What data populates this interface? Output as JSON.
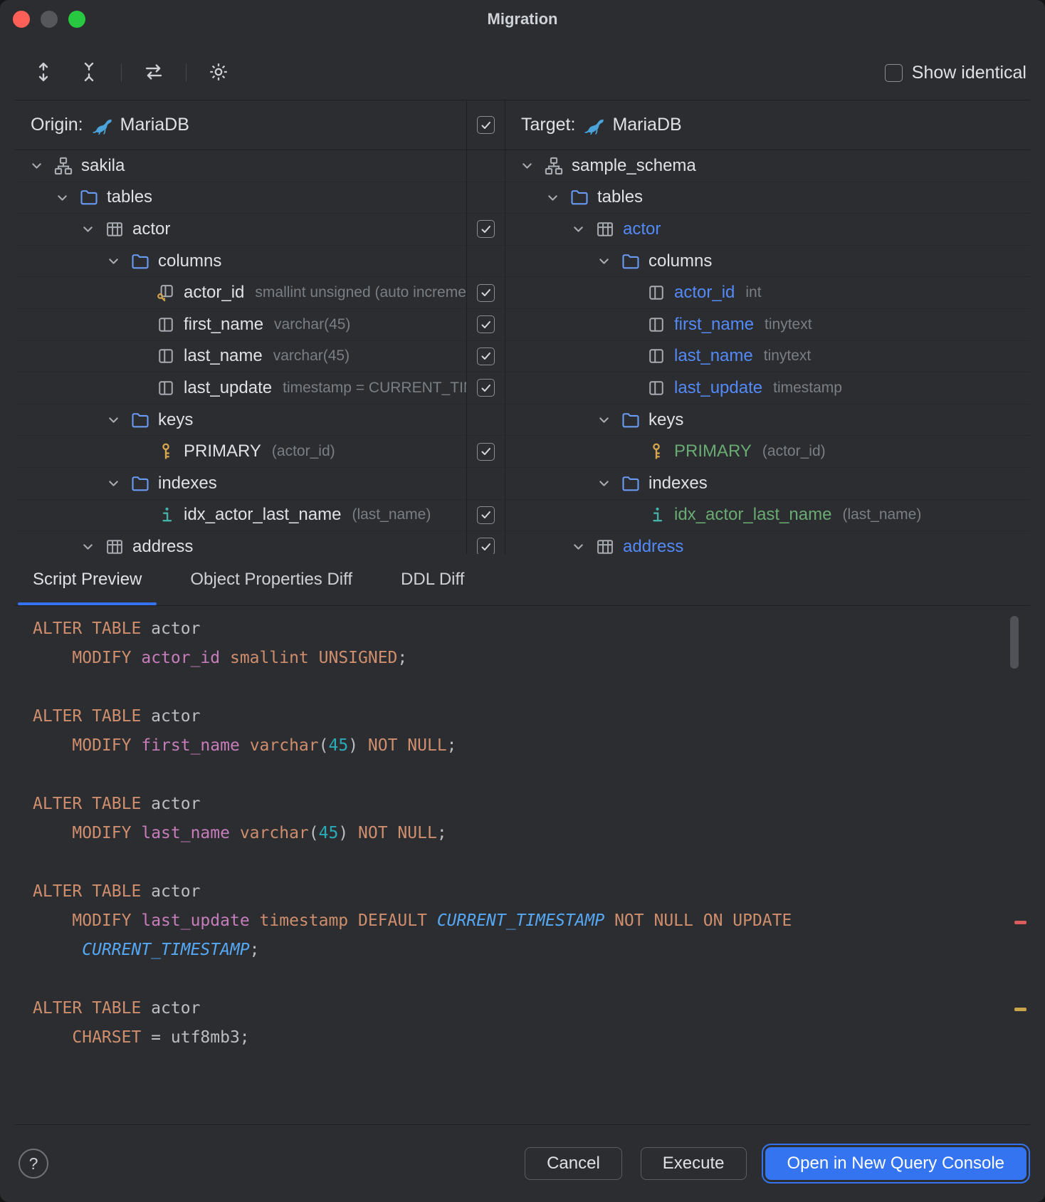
{
  "window": {
    "title": "Migration"
  },
  "colors": {
    "accent": "#3574F0",
    "modified_text": "#548AF7",
    "new_text": "#6AAB73",
    "keyword": "#CF8E6D",
    "column_name": "#C77DBB",
    "number": "#2AACB8",
    "function": "#56A8F5",
    "error_stripe_red": "#DB5C5C",
    "error_stripe_yellow": "#C8A549"
  },
  "toolbar": {
    "icons": [
      "expand-all",
      "collapse-all",
      "sync",
      "settings"
    ],
    "show_identical_label": "Show identical",
    "show_identical_checked": false
  },
  "headers": {
    "origin_label": "Origin:",
    "origin_db": "MariaDB",
    "target_label": "Target:",
    "target_db": "MariaDB",
    "select_all_checked": true
  },
  "tree": {
    "rows": [
      {
        "depth": 0,
        "left": {
          "icon": "schema",
          "label": "sakila",
          "expanded": true
        },
        "check": null,
        "right": {
          "icon": "schema",
          "label": "sample_schema",
          "expanded": true
        }
      },
      {
        "depth": 1,
        "left": {
          "icon": "folder",
          "label": "tables",
          "expanded": true
        },
        "check": null,
        "right": {
          "icon": "folder",
          "label": "tables",
          "expanded": true
        }
      },
      {
        "depth": 2,
        "left": {
          "icon": "table",
          "label": "actor",
          "expanded": true
        },
        "check": true,
        "right": {
          "icon": "table",
          "label": "actor",
          "expanded": true,
          "state": "modified"
        }
      },
      {
        "depth": 3,
        "left": {
          "icon": "folder",
          "label": "columns",
          "expanded": true
        },
        "check": null,
        "right": {
          "icon": "folder",
          "label": "columns",
          "expanded": true
        }
      },
      {
        "depth": 4,
        "left": {
          "icon": "column-key",
          "label": "actor_id",
          "hint": "smallint unsigned (auto increme"
        },
        "check": true,
        "right": {
          "icon": "column",
          "label": "actor_id",
          "hint": "int",
          "state": "modified"
        }
      },
      {
        "depth": 4,
        "left": {
          "icon": "column",
          "label": "first_name",
          "hint": "varchar(45)"
        },
        "check": true,
        "right": {
          "icon": "column",
          "label": "first_name",
          "hint": "tinytext",
          "state": "modified"
        }
      },
      {
        "depth": 4,
        "left": {
          "icon": "column",
          "label": "last_name",
          "hint": "varchar(45)"
        },
        "check": true,
        "right": {
          "icon": "column",
          "label": "last_name",
          "hint": "tinytext",
          "state": "modified"
        }
      },
      {
        "depth": 4,
        "left": {
          "icon": "column",
          "label": "last_update",
          "hint": "timestamp = CURRENT_TIM"
        },
        "check": true,
        "right": {
          "icon": "column",
          "label": "last_update",
          "hint": "timestamp",
          "state": "modified"
        }
      },
      {
        "depth": 3,
        "left": {
          "icon": "folder",
          "label": "keys",
          "expanded": true
        },
        "check": null,
        "right": {
          "icon": "folder",
          "label": "keys",
          "expanded": true
        }
      },
      {
        "depth": 4,
        "left": {
          "icon": "key",
          "label": "PRIMARY",
          "hint": "(actor_id)"
        },
        "check": true,
        "right": {
          "icon": "key",
          "label": "PRIMARY",
          "hint": "(actor_id)",
          "state": "new"
        }
      },
      {
        "depth": 3,
        "left": {
          "icon": "folder",
          "label": "indexes",
          "expanded": true
        },
        "check": null,
        "right": {
          "icon": "folder",
          "label": "indexes",
          "expanded": true
        }
      },
      {
        "depth": 4,
        "left": {
          "icon": "index",
          "label": "idx_actor_last_name",
          "hint": "(last_name)"
        },
        "check": true,
        "right": {
          "icon": "index",
          "label": "idx_actor_last_name",
          "hint": "(last_name)",
          "state": "new"
        }
      },
      {
        "depth": 2,
        "left": {
          "icon": "table",
          "label": "address",
          "expanded": true
        },
        "check": true,
        "right": {
          "icon": "table",
          "label": "address",
          "expanded": true,
          "state": "modified"
        }
      }
    ]
  },
  "tabs": [
    {
      "label": "Script Preview",
      "active": true
    },
    {
      "label": "Object Properties Diff",
      "active": false
    },
    {
      "label": "DDL Diff",
      "active": false
    }
  ],
  "editor": {
    "lines": [
      [
        {
          "t": "ALTER TABLE",
          "c": "kw"
        },
        {
          "t": " actor"
        }
      ],
      [
        {
          "t": "    "
        },
        {
          "t": "MODIFY",
          "c": "kw"
        },
        {
          "t": " "
        },
        {
          "t": "actor_id",
          "c": "col"
        },
        {
          "t": " "
        },
        {
          "t": "smallint",
          "c": "kw"
        },
        {
          "t": " "
        },
        {
          "t": "UNSIGNED",
          "c": "kw"
        },
        {
          "t": ";"
        }
      ],
      [],
      [
        {
          "t": "ALTER TABLE",
          "c": "kw"
        },
        {
          "t": " actor"
        }
      ],
      [
        {
          "t": "    "
        },
        {
          "t": "MODIFY",
          "c": "kw"
        },
        {
          "t": " "
        },
        {
          "t": "first_name",
          "c": "col"
        },
        {
          "t": " "
        },
        {
          "t": "varchar",
          "c": "kw"
        },
        {
          "t": "("
        },
        {
          "t": "45",
          "c": "num"
        },
        {
          "t": ") "
        },
        {
          "t": "NOT NULL",
          "c": "kw"
        },
        {
          "t": ";"
        }
      ],
      [],
      [
        {
          "t": "ALTER TABLE",
          "c": "kw"
        },
        {
          "t": " actor"
        }
      ],
      [
        {
          "t": "    "
        },
        {
          "t": "MODIFY",
          "c": "kw"
        },
        {
          "t": " "
        },
        {
          "t": "last_name",
          "c": "col"
        },
        {
          "t": " "
        },
        {
          "t": "varchar",
          "c": "kw"
        },
        {
          "t": "("
        },
        {
          "t": "45",
          "c": "num"
        },
        {
          "t": ") "
        },
        {
          "t": "NOT NULL",
          "c": "kw"
        },
        {
          "t": ";"
        }
      ],
      [],
      [
        {
          "t": "ALTER TABLE",
          "c": "kw"
        },
        {
          "t": " actor"
        }
      ],
      [
        {
          "t": "    "
        },
        {
          "t": "MODIFY",
          "c": "kw"
        },
        {
          "t": " "
        },
        {
          "t": "last_update",
          "c": "col"
        },
        {
          "t": " "
        },
        {
          "t": "timestamp",
          "c": "kw"
        },
        {
          "t": " "
        },
        {
          "t": "DEFAULT",
          "c": "kw"
        },
        {
          "t": " "
        },
        {
          "t": "CURRENT_TIMESTAMP",
          "c": "fn"
        },
        {
          "t": " "
        },
        {
          "t": "NOT NULL",
          "c": "kw"
        },
        {
          "t": " "
        },
        {
          "t": "ON UPDATE",
          "c": "kw"
        }
      ],
      [
        {
          "t": "     "
        },
        {
          "t": "CURRENT_TIMESTAMP",
          "c": "fn"
        },
        {
          "t": ";"
        }
      ],
      [],
      [
        {
          "t": "ALTER TABLE",
          "c": "kw"
        },
        {
          "t": " actor"
        }
      ],
      [
        {
          "t": "    "
        },
        {
          "t": "CHARSET",
          "c": "kw"
        },
        {
          "t": " = utf8mb3;"
        }
      ]
    ]
  },
  "footer": {
    "help": "?",
    "cancel": "Cancel",
    "execute": "Execute",
    "open": "Open in New Query Console"
  }
}
